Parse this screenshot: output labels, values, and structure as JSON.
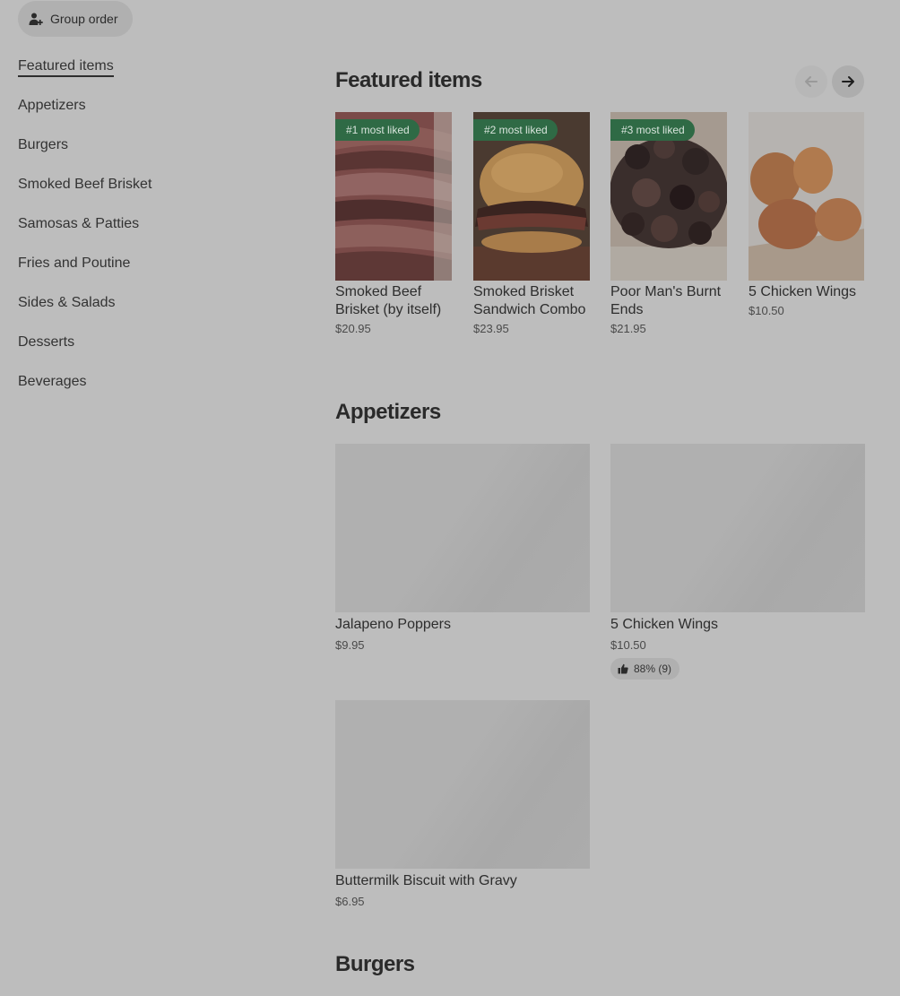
{
  "group_order": {
    "label": "Group order"
  },
  "sidebar": {
    "items": [
      {
        "label": "Featured items",
        "active": true
      },
      {
        "label": "Appetizers"
      },
      {
        "label": "Burgers"
      },
      {
        "label": "Smoked Beef Brisket"
      },
      {
        "label": "Samosas & Patties"
      },
      {
        "label": "Fries and Poutine"
      },
      {
        "label": "Sides & Salads"
      },
      {
        "label": "Desserts"
      },
      {
        "label": "Beverages"
      }
    ]
  },
  "featured": {
    "title": "Featured items",
    "items": [
      {
        "badge": "#1 most liked",
        "name": "Smoked Beef Brisket (by itself)",
        "price": "$20.95"
      },
      {
        "badge": "#2 most liked",
        "name": "Smoked Brisket Sandwich Combo",
        "price": "$23.95"
      },
      {
        "badge": "#3 most liked",
        "name": "Poor Man's Burnt Ends",
        "price": "$21.95"
      },
      {
        "name": "5 Chicken Wings",
        "price": "$10.50"
      }
    ]
  },
  "appetizers": {
    "title": "Appetizers",
    "items": [
      {
        "name": "Jalapeno Poppers",
        "price": "$9.95"
      },
      {
        "name": "5 Chicken Wings",
        "price": "$10.50",
        "rating": "88% (9)"
      },
      {
        "name": "Buttermilk Biscuit with Gravy",
        "price": "$6.95"
      }
    ]
  },
  "burgers": {
    "title": "Burgers"
  },
  "colors": {
    "badge_bg": "#2f6a45",
    "overlay": "#bdbdbd"
  }
}
